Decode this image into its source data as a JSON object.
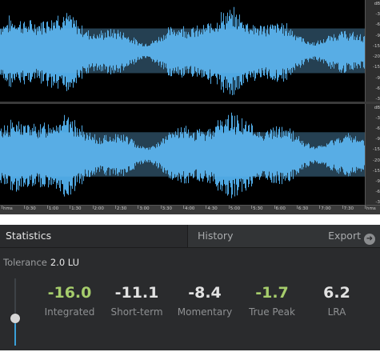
{
  "editor": {
    "waveform_color": "#4fa8e2",
    "channel_bg": "#000000",
    "scale_labels": [
      "dB",
      "-3",
      "-6",
      "-9",
      "-15",
      "-20",
      "-15",
      "-9",
      "-6",
      "-3"
    ],
    "timeline_labels": [
      "hms",
      "0:30",
      "1:00",
      "1:30",
      "2:00",
      "2:30",
      "3:00",
      "3:30",
      "4:00",
      "4:30",
      "5:00",
      "5:30",
      "6:00",
      "6:30",
      "7:00",
      "7:30",
      "hms"
    ]
  },
  "tabs": {
    "statistics": "Statistics",
    "history": "History",
    "export": "Export",
    "export_icon": "arrow-right-circle-icon"
  },
  "tolerance": {
    "label": "Tolerance",
    "value": "2.0 LU"
  },
  "slider": {
    "level_fraction": 0.4
  },
  "stats": {
    "integrated": {
      "value": "-16.0",
      "label": "Integrated",
      "color": "#a6cd6c"
    },
    "short_term": {
      "value": "-11.1",
      "label": "Short-term",
      "color": "#e2e2e2"
    },
    "momentary": {
      "value": "-8.4",
      "label": "Momentary",
      "color": "#e2e2e2"
    },
    "true_peak": {
      "value": "-1.7",
      "label": "True Peak",
      "color": "#a6cd6c"
    },
    "lra": {
      "value": "6.2",
      "label": "LRA",
      "color": "#e2e2e2"
    }
  }
}
